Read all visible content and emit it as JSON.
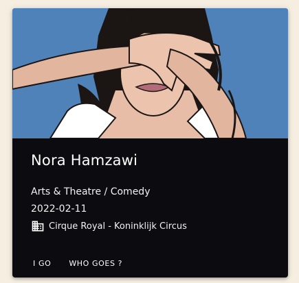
{
  "event": {
    "title": "Nora Hamzawi",
    "genre": "Arts & Theatre / Comedy",
    "date": "2022-02-11",
    "venue": "Cirque Royal - Koninklijk Circus",
    "venue_icon": "building-icon",
    "image_alt": "Illustration of a woman covering her eyes with her hand"
  },
  "actions": {
    "i_go_label": "I GO",
    "who_goes_label": "WHO GOES ?"
  },
  "colors": {
    "card_background": "#0c0c10",
    "page_background": "#f6efe1",
    "image_background": "#5586b9",
    "text": "#ffffff"
  }
}
